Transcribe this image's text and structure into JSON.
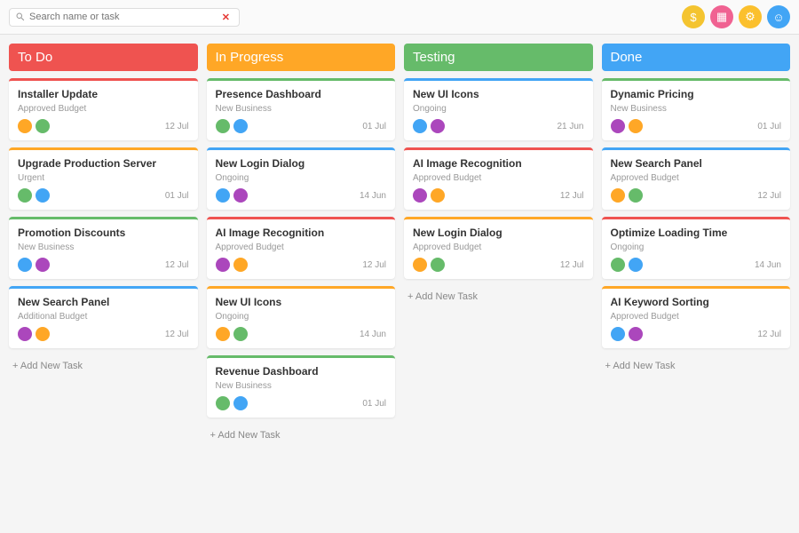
{
  "search": {
    "placeholder": "Search name or task"
  },
  "columns": [
    {
      "title": "To Do",
      "color": "red",
      "cards": [
        {
          "title": "Installer Update",
          "sub": "Approved Budget",
          "date": "12 Jul",
          "accent": "red"
        },
        {
          "title": "Upgrade Production Server",
          "sub": "Urgent",
          "date": "01 Jul",
          "accent": "orange"
        },
        {
          "title": "Promotion Discounts",
          "sub": "New Business",
          "date": "12 Jul",
          "accent": "green"
        },
        {
          "title": "New Search Panel",
          "sub": "Additional Budget",
          "date": "12 Jul",
          "accent": "blue"
        }
      ]
    },
    {
      "title": "In Progress",
      "color": "orange",
      "cards": [
        {
          "title": "Presence Dashboard",
          "sub": "New Business",
          "date": "01 Jul",
          "accent": "green"
        },
        {
          "title": "New Login Dialog",
          "sub": "Ongoing",
          "date": "14 Jun",
          "accent": "blue"
        },
        {
          "title": "AI Image Recognition",
          "sub": "Approved Budget",
          "date": "12 Jul",
          "accent": "red"
        },
        {
          "title": "New UI Icons",
          "sub": "Ongoing",
          "date": "14 Jun",
          "accent": "orange"
        },
        {
          "title": "Revenue Dashboard",
          "sub": "New Business",
          "date": "01 Jul",
          "accent": "green"
        }
      ]
    },
    {
      "title": "Testing",
      "color": "green",
      "cards": [
        {
          "title": "New UI Icons",
          "sub": "Ongoing",
          "date": "21 Jun",
          "accent": "blue"
        },
        {
          "title": "AI Image Recognition",
          "sub": "Approved Budget",
          "date": "12 Jul",
          "accent": "red"
        },
        {
          "title": "New Login Dialog",
          "sub": "Approved Budget",
          "date": "12 Jul",
          "accent": "orange"
        }
      ]
    },
    {
      "title": "Done",
      "color": "blue",
      "cards": [
        {
          "title": "Dynamic Pricing",
          "sub": "New Business",
          "date": "01 Jul",
          "accent": "green"
        },
        {
          "title": "New Search Panel",
          "sub": "Approved Budget",
          "date": "12 Jul",
          "accent": "blue"
        },
        {
          "title": "Optimize Loading Time",
          "sub": "Ongoing",
          "date": "14 Jun",
          "accent": "red"
        },
        {
          "title": "AI Keyword Sorting",
          "sub": "Approved Budget",
          "date": "12 Jul",
          "accent": "orange"
        }
      ]
    }
  ],
  "addLabel": "+ Add New Task"
}
